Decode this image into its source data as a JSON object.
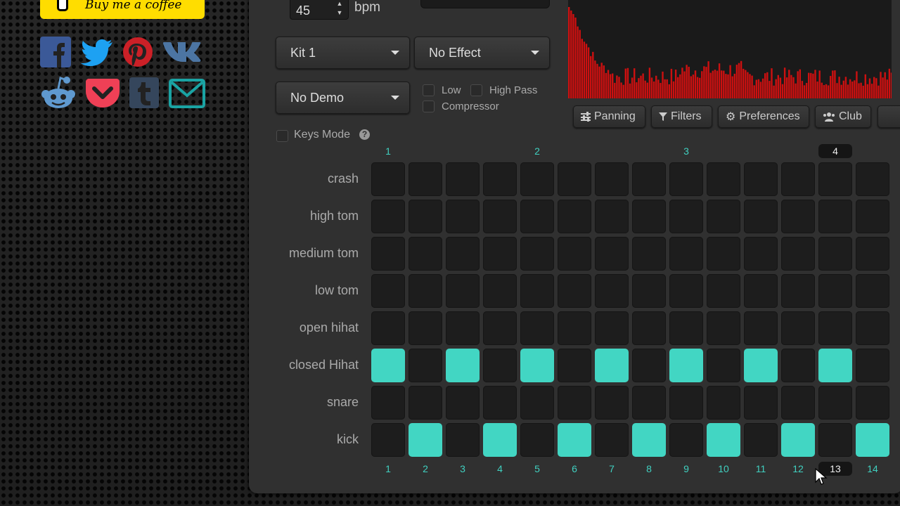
{
  "coffee": {
    "label": "Buy me a coffee"
  },
  "social": [
    {
      "name": "facebook-icon",
      "color": "#3b5998"
    },
    {
      "name": "twitter-icon",
      "color": "#1da1f2"
    },
    {
      "name": "pinterest-icon",
      "color": "#cb2027"
    },
    {
      "name": "vk-icon",
      "color": "#4c75a3"
    },
    {
      "name": "reddit-icon",
      "color": "#5f99cf"
    },
    {
      "name": "pocket-icon",
      "color": "#ef4056"
    },
    {
      "name": "tumblr-icon",
      "color": "#35465c"
    },
    {
      "name": "email-icon",
      "color": "#1aa3a3"
    }
  ],
  "tempo": {
    "value": "45",
    "unit": "bpm"
  },
  "selects": {
    "kit": "Kit 1",
    "effect": "No Effect",
    "demo": "No Demo"
  },
  "filters": {
    "low": "Low",
    "high_pass": "High Pass",
    "compressor": "Compressor"
  },
  "keys_mode": {
    "label": "Keys Mode",
    "help": "?"
  },
  "toolbar": {
    "panning": "Panning",
    "filters": "Filters",
    "preferences": "Preferences",
    "club": "Club"
  },
  "beats": [
    "1",
    "2",
    "3",
    "4"
  ],
  "current_beat": 3,
  "rows": [
    "crash",
    "high tom",
    "medium tom",
    "low tom",
    "open hihat",
    "closed Hihat",
    "snare",
    "kick"
  ],
  "pattern": {
    "closed Hihat": [
      1,
      0,
      1,
      0,
      1,
      0,
      1,
      0,
      1,
      0,
      1,
      0,
      1,
      0
    ],
    "kick": [
      0,
      1,
      0,
      1,
      0,
      1,
      0,
      1,
      0,
      1,
      0,
      1,
      0,
      1
    ]
  },
  "steps": [
    "1",
    "2",
    "3",
    "4",
    "5",
    "6",
    "7",
    "8",
    "9",
    "10",
    "11",
    "12",
    "13",
    "14"
  ],
  "current_step": 12,
  "colors": {
    "accent": "#42d6c3",
    "viz": "#cc1010",
    "coffee": "#ffdd00"
  }
}
